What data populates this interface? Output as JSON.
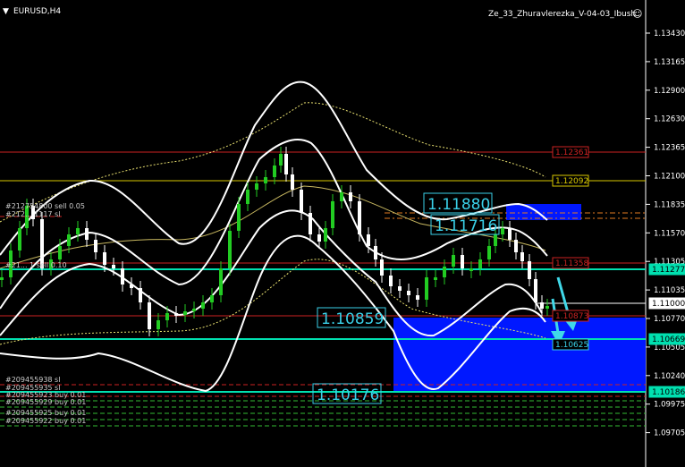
{
  "window": {
    "symbol": "EURUSD,H4",
    "indicator": "Ze_33_Zhuravlerezka_V-04-03_Ibush",
    "smiley": "☺",
    "menu_arrow": "▼"
  },
  "colors": {
    "background": "#000000",
    "bull_candle": "#22cc22",
    "bear_candle": "#ffffff",
    "band_white": "#ffffff",
    "band_yellow": "#e8e070",
    "red_line": "#cc2222",
    "yellow_line": "#d8c800",
    "teal_line": "#00e0b0",
    "blue_box": "#0018ff",
    "label_cyan": "#3ad0e8",
    "arrow_cyan": "#40d8e8"
  },
  "axis_ticks": [
    "1.13430",
    "1.13165",
    "1.12900",
    "1.12630",
    "1.12365",
    "1.12100",
    "1.11835",
    "1.11570",
    "1.11305",
    "1.11035",
    "1.10770",
    "1.10505",
    "1.10240",
    "1.09975",
    "1.09705"
  ],
  "price_tags": [
    {
      "text": "1.12361",
      "color": "#cc2222",
      "border": "#cc2222"
    },
    {
      "text": "1.12092",
      "color": "#d8c800",
      "border": "#d8c800"
    },
    {
      "text": "1.11358",
      "color": "#cc2222",
      "border": "#cc2222"
    },
    {
      "text": "1.11277",
      "color": "#000000",
      "border": "#00e0b0",
      "fill": "#00e0b0"
    },
    {
      "text": "1.11000",
      "color": "#000000",
      "border": "#ffffff",
      "fill": "#ffffff"
    },
    {
      "text": "1.10873",
      "color": "#cc2222",
      "border": "#cc2222"
    },
    {
      "text": "1.10669",
      "color": "#000000",
      "border": "#00e0b0",
      "fill": "#00e0b0"
    },
    {
      "text": "1.10625",
      "color": "#3ad0e8",
      "border": "#3ad0e8"
    },
    {
      "text": "1.10186",
      "color": "#000000",
      "border": "#00e0b0",
      "fill": "#00e0b0"
    }
  ],
  "big_labels": [
    {
      "text": "1.11880",
      "name": "level-label-1-11880"
    },
    {
      "text": "1.11716",
      "name": "level-label-1-11716"
    },
    {
      "text": "1.10859",
      "name": "level-label-1-10859"
    },
    {
      "text": "1.10176",
      "name": "level-label-1-10176"
    }
  ],
  "order_labels": [
    "#212754800 sell 0.05",
    "#212... 1117 sl",
    "#21... 1 sell 0.10",
    "#209455938 sl",
    "#209455935 sl",
    "#209455923 buy 0.01",
    "#209455929 buy 0.01",
    "#209455925 buy 0.01",
    "#209455922 buy 0.01"
  ]
}
